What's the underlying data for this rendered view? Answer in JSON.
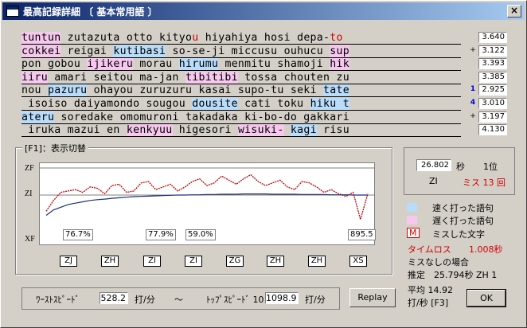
{
  "window": {
    "title": "最高記録詳細 〔 基本常用語 〕",
    "close_glyph": "×"
  },
  "rows": [
    [
      [
        "tuntun",
        "slow"
      ],
      [
        " zutazuta otto kityo",
        ""
      ],
      [
        "u",
        "miss"
      ],
      [
        " hiyahiya hosi depa-",
        ""
      ],
      [
        "to",
        "miss"
      ]
    ],
    [
      [
        "cokkei",
        "slow"
      ],
      [
        " reigai ",
        ""
      ],
      [
        "kutibasi",
        "fast"
      ],
      [
        " so-se-ji miccusu ouhucu ",
        ""
      ],
      [
        "sup",
        "slow"
      ]
    ],
    [
      [
        "pon",
        ""
      ],
      [
        " gobou ",
        ""
      ],
      [
        "ijikeru",
        "slow"
      ],
      [
        " morau ",
        ""
      ],
      [
        "hirumu",
        "fast"
      ],
      [
        " menmitu shamoji ",
        ""
      ],
      [
        "hik",
        "slow"
      ]
    ],
    [
      [
        "iiru",
        "slow"
      ],
      [
        " amari seitou ma-jan ",
        ""
      ],
      [
        "tibitibi",
        "slow"
      ],
      [
        " tossa chouten zu",
        ""
      ]
    ],
    [
      [
        "nou ",
        ""
      ],
      [
        "pazuru",
        "fast"
      ],
      [
        " ohayou zuruzuru kasai supo-tu seki ",
        ""
      ],
      [
        "tate",
        "fast"
      ]
    ],
    [
      [
        " isoiso daiyamondo sougou ",
        ""
      ],
      [
        "dousite",
        "fast"
      ],
      [
        " cati toku ",
        ""
      ],
      [
        "hiku t",
        "fast"
      ]
    ],
    [
      [
        "ateru",
        "fast"
      ],
      [
        " soredake omomuroni takadaka ki-bo-do gakkari",
        ""
      ]
    ],
    [
      [
        " iruka mazui en ",
        ""
      ],
      [
        "kenkyuu",
        "slow"
      ],
      [
        " higesori ",
        ""
      ],
      [
        "wisuki-",
        "slow"
      ],
      [
        " ",
        ""
      ],
      [
        "kagi",
        "fast"
      ],
      [
        " risu",
        ""
      ]
    ]
  ],
  "scores": [
    {
      "mark": "",
      "value": "3.640"
    },
    {
      "mark": "+",
      "value": "3.122"
    },
    {
      "mark": "",
      "value": "3.393"
    },
    {
      "mark": "",
      "value": "3.385"
    },
    {
      "mark": "1",
      "value": "2.925"
    },
    {
      "mark": "4",
      "value": "3.010"
    },
    {
      "mark": "+",
      "value": "3.197"
    },
    {
      "mark": "",
      "value": "4.130"
    }
  ],
  "graph": {
    "title": "[F1]：表示切替",
    "y_labels": [
      "ZF",
      "ZI",
      "XF"
    ],
    "percents": [
      "76.7%",
      "77.9%",
      "59.0%",
      "895.5"
    ],
    "tags": [
      "ZJ",
      "ZH",
      "ZI",
      "ZI",
      "ZG",
      "ZH",
      "ZH",
      "XS"
    ]
  },
  "chart_data": {
    "type": "line",
    "series": [
      {
        "values": [
          -0.6,
          -0.2,
          0.1,
          0.15,
          0.2,
          0.1,
          0.3,
          0.25,
          0.05,
          0.35,
          0.4,
          0.1,
          0.15,
          0.45,
          0.5,
          0.2,
          0.3,
          0.4,
          0.15,
          0.3,
          0.5,
          0.6,
          0.35,
          0.45,
          0.7,
          0.55,
          0.4,
          0.6,
          0.75,
          0.5,
          0.35,
          0.45,
          0.55,
          0.3,
          0.2,
          0.5,
          0.45,
          0.3,
          0.1,
          0.2,
          0.05,
          -0.05,
          0.1,
          -0.9,
          0.05
        ]
      },
      {
        "values": [
          -0.75,
          -0.55,
          -0.45,
          -0.35,
          -0.3,
          -0.25,
          -0.2,
          -0.17,
          -0.15,
          -0.12,
          -0.1,
          -0.08,
          -0.06,
          -0.05,
          -0.04,
          -0.03,
          -0.02,
          -0.01,
          0,
          0,
          0.01,
          0.01,
          0.02,
          0.02,
          0.03,
          0.03,
          0.03,
          0.04,
          0.04,
          0.04,
          0.04,
          0.03,
          0.03,
          0.03,
          0.03,
          0.02,
          0.02,
          0.02,
          0.02,
          0.01,
          0.01,
          0.01,
          0,
          0,
          0
        ]
      }
    ]
  },
  "side": {
    "time": "26.802",
    "time_unit": "秒",
    "rank": "1位",
    "grade": "ZI",
    "miss_label": "ミス 13 回",
    "legend_fast": "速く打った語句",
    "legend_slow": "遅く打った語句",
    "miss_mark": "M",
    "legend_miss": "ミスした文字",
    "timeloss_label": "タイムロス",
    "timeloss_value": "1.008秒",
    "nomiss_label": "ミスなしの場合",
    "estimate": "推定　25.794秒 ZH 1",
    "average": "平均 14.92",
    "average_unit": "打/秒 [F3]",
    "colors": {
      "fast": "#b9dcfa",
      "slow": "#f6c8ee",
      "miss": "#d00000"
    }
  },
  "bottom": {
    "worst_label": "ﾜｰｽﾄｽﾋﾟｰﾄﾞ",
    "worst_value": "528.2",
    "unit": "打/分",
    "tilde": "～",
    "top_label": "ﾄｯﾌﾟｽﾋﾟｰﾄﾞ 10",
    "top_value": "1098.9",
    "unit2": "打/分",
    "replay": "Replay",
    "ok": "OK"
  }
}
